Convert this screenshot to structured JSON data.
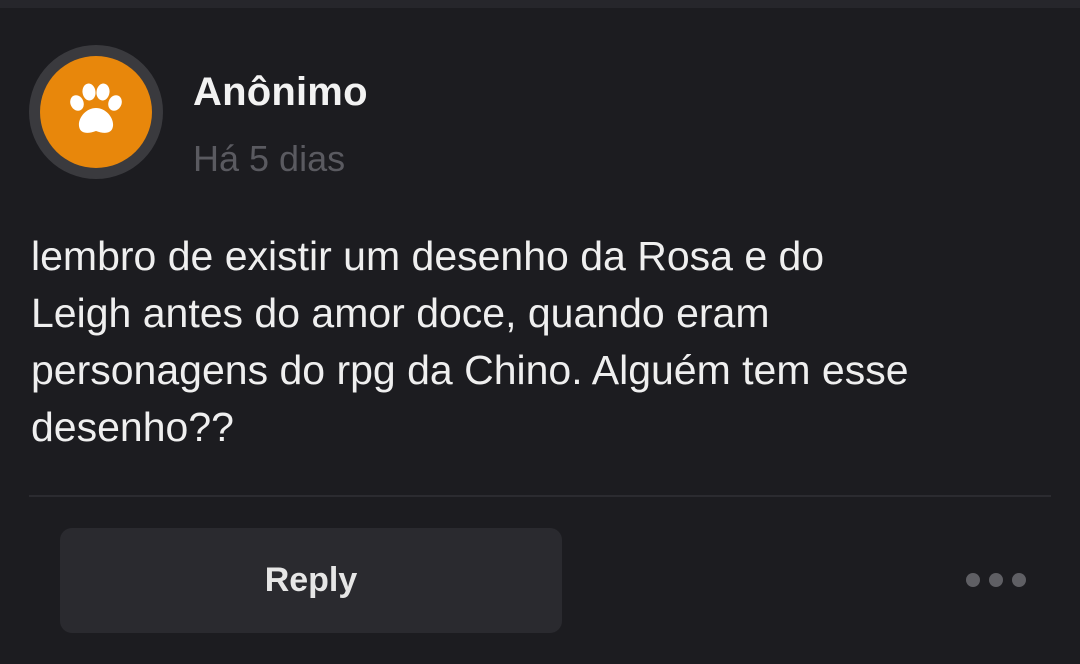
{
  "post": {
    "author": "Anônimo",
    "timestamp": "Há 5 dias",
    "avatar_icon": "paw-icon",
    "avatar_color": "#e8870b",
    "body": "lembro de existir um desenho da Rosa e do\nLeigh antes do amor doce, quando eram\npersonagens do rpg da Chino. Alguém tem esse\ndesenho??"
  },
  "actions": {
    "reply_label": "Reply",
    "more_icon": "more-dots-icon"
  },
  "colors": {
    "background": "#1c1c20",
    "button": "#2a2a2f",
    "text": "#efefef",
    "muted": "#5a5a60"
  }
}
